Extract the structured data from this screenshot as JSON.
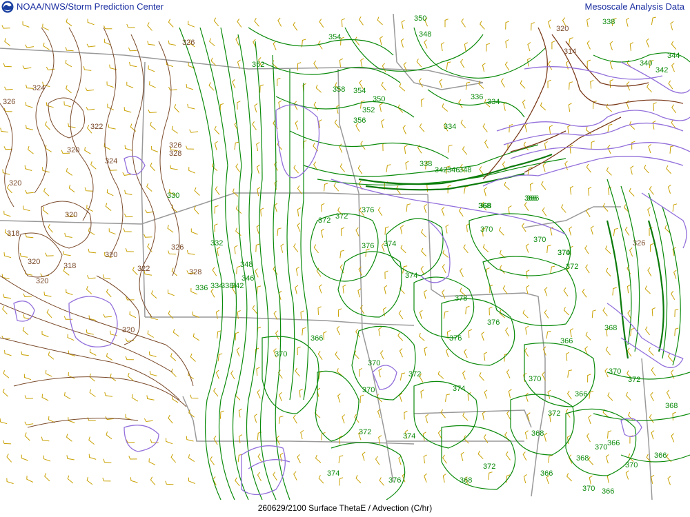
{
  "header": {
    "left_title": "NOAA/NWS/Storm Prediction Center",
    "right_title": "Mesoscale Analysis Data",
    "logo_icon": "noaa-logo"
  },
  "footer": {
    "caption": "260629/2100 Surface ThetaE / Advection (C/hr)"
  },
  "colors": {
    "thetae_low": "#7a4a2a",
    "thetae_high": "#0a8a0a",
    "advection": "#9370db",
    "borders": "#999999",
    "wind_barbs": "#c8a000",
    "title_text": "#1a2ea0"
  },
  "contour_labels_brown": [
    "326",
    "324",
    "326",
    "322",
    "320",
    "324",
    "320",
    "326",
    "328",
    "320",
    "318",
    "320",
    "318",
    "320",
    "320",
    "322",
    "328",
    "320",
    "326",
    "320",
    "314",
    "326"
  ],
  "contour_labels_green": [
    "350",
    "348",
    "354",
    "352",
    "358",
    "354",
    "350",
    "352",
    "356",
    "334",
    "336",
    "334",
    "338",
    "342",
    "346",
    "348",
    "330",
    "332",
    "336",
    "334",
    "338",
    "342",
    "346",
    "348",
    "370",
    "376",
    "372",
    "372",
    "376",
    "374",
    "374",
    "378",
    "376",
    "376",
    "366",
    "370",
    "370",
    "368",
    "366",
    "370",
    "374",
    "372",
    "366",
    "368",
    "370",
    "370",
    "372",
    "374",
    "372",
    "366",
    "368",
    "370",
    "372",
    "374",
    "368",
    "372",
    "370",
    "366",
    "368",
    "370",
    "366",
    "370",
    "366",
    "368",
    "366",
    "340",
    "342",
    "344",
    "338",
    "368",
    "366",
    "370",
    "374",
    "372",
    "376"
  ]
}
